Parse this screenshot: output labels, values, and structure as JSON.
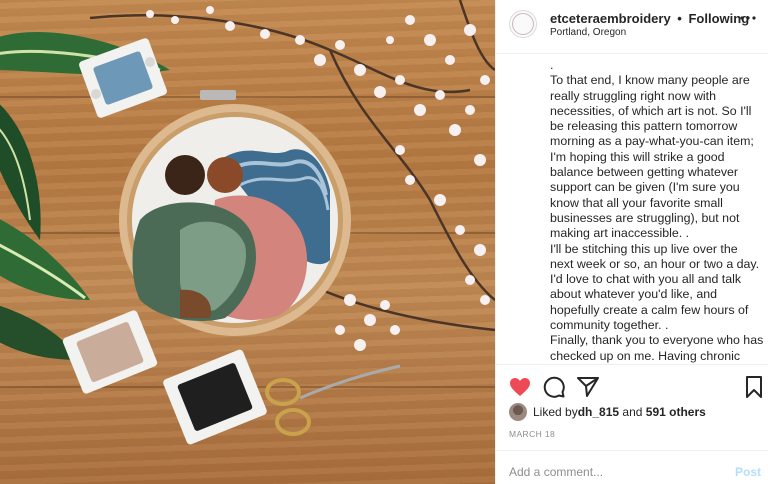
{
  "header": {
    "username": "etceteraembroidery",
    "separator": "•",
    "follow_status": "Following",
    "location": "Portland, Oregon",
    "more_icon": "more-options-icon"
  },
  "caption": {
    "lines": [
      ".",
      "To that end, I know many people are really struggling right now with necessities, of which art is not. So I'll be releasing this pattern tomorrow morning as a pay-what-you-can item; I'm hoping this will strike a good balance between getting whatever support can be given (I'm sure you know that all your favorite small businesses are struggling), but not making art inaccessible. .",
      "I'll be stitching this up live over the next week or so, an hour or two a day. I'd love to chat with you all and talk about whatever you'd like, and hopefully create a calm few hours of community together. .",
      "Finally, thank you to everyone who has checked up on me. Having chronic illnesses means that it's even harder"
    ]
  },
  "actions": {
    "like_icon": "heart-icon",
    "comment_icon": "comment-icon",
    "share_icon": "share-icon",
    "save_icon": "bookmark-icon",
    "like_color": "#ed4956"
  },
  "likes": {
    "prefix": "Liked by ",
    "user": "dh_815",
    "middle": " and ",
    "others": "591 others"
  },
  "date": "MARCH 18",
  "comment": {
    "placeholder": "Add a comment...",
    "post_label": "Post"
  }
}
